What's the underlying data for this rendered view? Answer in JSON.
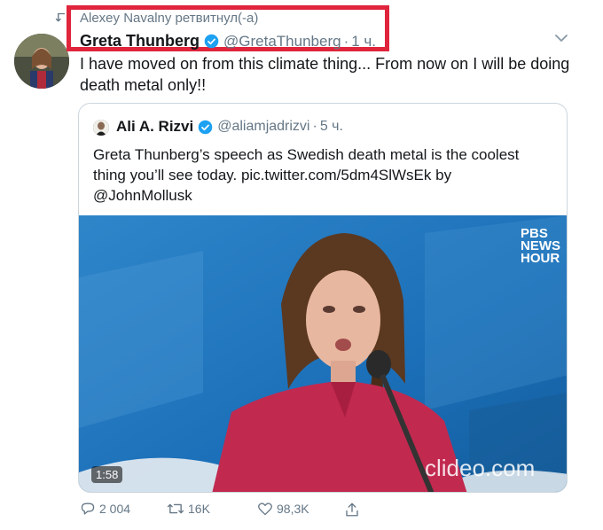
{
  "retweet": {
    "label": "Alexey Navalny ретвитнул(-а)"
  },
  "tweet": {
    "author_name": "Greta Thunberg",
    "author_handle": "@GretaThunberg",
    "time_sep": "·",
    "time": "1 ч.",
    "text": "I have moved on from this climate thing... From now on I will be doing death metal only!!"
  },
  "quote": {
    "author_name": "Ali A. Rizvi",
    "author_handle": "@aliamjadrizvi",
    "time_sep": "·",
    "time": "5 ч.",
    "text": "Greta Thunberg’s speech as Swedish  death metal is the coolest thing you’ll see today. pic.twitter.com/5dm4SlWsEk by @JohnMollusk",
    "video": {
      "duration": "1:58",
      "pbs_logo": [
        "PBS",
        "NEWS",
        "HOUR"
      ],
      "watermark": "clideo.com"
    }
  },
  "actions": {
    "replies": "2 004",
    "retweets": "16K",
    "likes": "98,3K"
  },
  "colors": {
    "highlight": "#e0243c",
    "verified": "#1da1f2",
    "muted": "#657786"
  }
}
